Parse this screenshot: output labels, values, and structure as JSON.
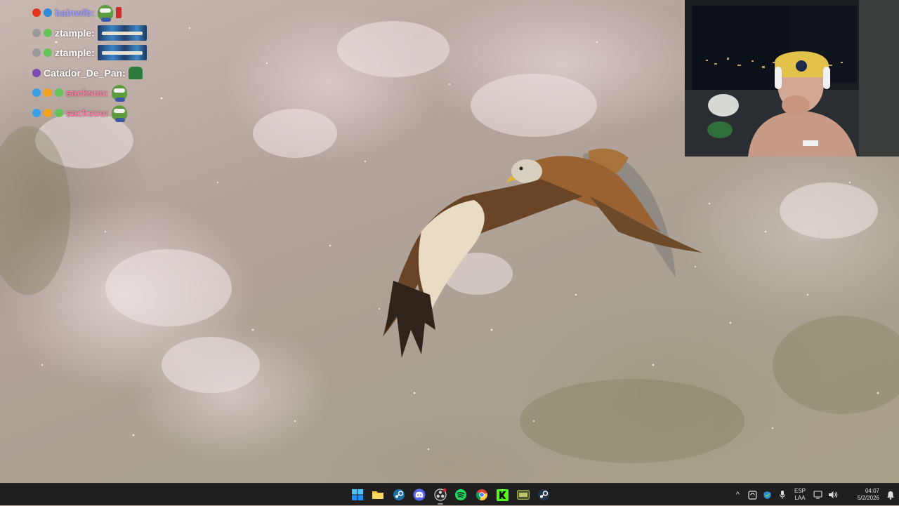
{
  "chat": {
    "messages": [
      {
        "username": "bainwlb:",
        "color": "#9b9bff",
        "badges": [
          "#e2351d",
          "#2f8bd6"
        ],
        "emotes": [
          "pepe",
          "bottle"
        ]
      },
      {
        "username": "ztample:",
        "color": "#ffffff",
        "badges": [
          "#9a9a9a",
          "#64c45a"
        ],
        "emotes": [
          "wide"
        ]
      },
      {
        "username": "ztample:",
        "color": "#ffffff",
        "badges": [
          "#9a9a9a",
          "#64c45a"
        ],
        "emotes": [
          "wide"
        ]
      },
      {
        "username": "Catador_De_Pan:",
        "color": "#ffffff",
        "badges": [
          "#7a4ab0"
        ],
        "emotes": [
          "hat"
        ]
      },
      {
        "username": "sacksuu:",
        "color": "#ff7aa0",
        "badges": [
          "#3aa0e6",
          "#f3a21c",
          "#64c45a"
        ],
        "emotes": [
          "pepe"
        ]
      },
      {
        "username": "sacksuu:",
        "color": "#ff7aa0",
        "badges": [
          "#3aa0e6",
          "#f3a21c",
          "#64c45a"
        ],
        "emotes": [
          "pepe"
        ]
      }
    ]
  },
  "taskbar": {
    "apps": [
      {
        "name": "windows-start",
        "icon": "windows-icon",
        "active": false
      },
      {
        "name": "file-explorer",
        "icon": "folder-icon",
        "active": false
      },
      {
        "name": "steam",
        "icon": "steam-icon",
        "active": false
      },
      {
        "name": "discord",
        "icon": "discord-icon",
        "active": false
      },
      {
        "name": "obs",
        "icon": "obs-icon",
        "active": true
      },
      {
        "name": "spotify",
        "icon": "spotify-icon",
        "active": false
      },
      {
        "name": "chrome",
        "icon": "chrome-icon",
        "active": false
      },
      {
        "name": "kick",
        "icon": "kick-icon",
        "active": false
      },
      {
        "name": "game-launcher",
        "icon": "launcher-icon",
        "active": false
      },
      {
        "name": "steam-2",
        "icon": "steam-icon",
        "active": false
      }
    ],
    "tray": {
      "chevron": "^",
      "language_line1": "ESP",
      "language_line2": "LAA",
      "time": "04:07",
      "date": "5/2/2026"
    }
  },
  "colors": {
    "taskbar_bg": "#1f1f1f",
    "spotify": "#1ed760",
    "kick": "#53fc18",
    "discord": "#5865f2"
  }
}
